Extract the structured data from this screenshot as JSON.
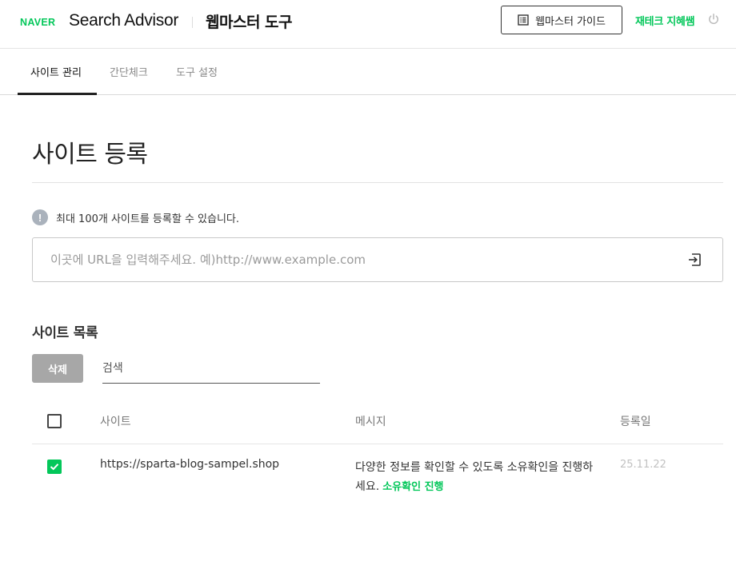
{
  "header": {
    "naver_logo": "NAVER",
    "product_name": "Search Advisor",
    "tool_name": "웹마스터 도구",
    "guide_button_label": "웹마스터 가이드",
    "user_name": "재테크 지혜쌤",
    "accent_color": "#03c75a"
  },
  "tabs": [
    {
      "label": "사이트 관리",
      "active": true
    },
    {
      "label": "간단체크",
      "active": false
    },
    {
      "label": "도구 설정",
      "active": false
    }
  ],
  "page": {
    "title": "사이트 등록",
    "notice_icon": "!",
    "notice": "최대 100개 사이트를 등록할 수 있습니다.",
    "url_placeholder": "이곳에 URL을 입력해주세요. 예)http://www.example.com"
  },
  "site_list": {
    "title": "사이트 목록",
    "delete_label": "삭제",
    "search_placeholder": "검색",
    "columns": {
      "site": "사이트",
      "message": "메시지",
      "date": "등록일"
    },
    "rows": [
      {
        "checked": true,
        "site": "https://sparta-blog-sampel.shop",
        "message": "다양한 정보를 확인할 수 있도록 소유확인을 진행하세요.",
        "action_label": "소유확인 진행",
        "date": "25.11.22"
      }
    ]
  }
}
